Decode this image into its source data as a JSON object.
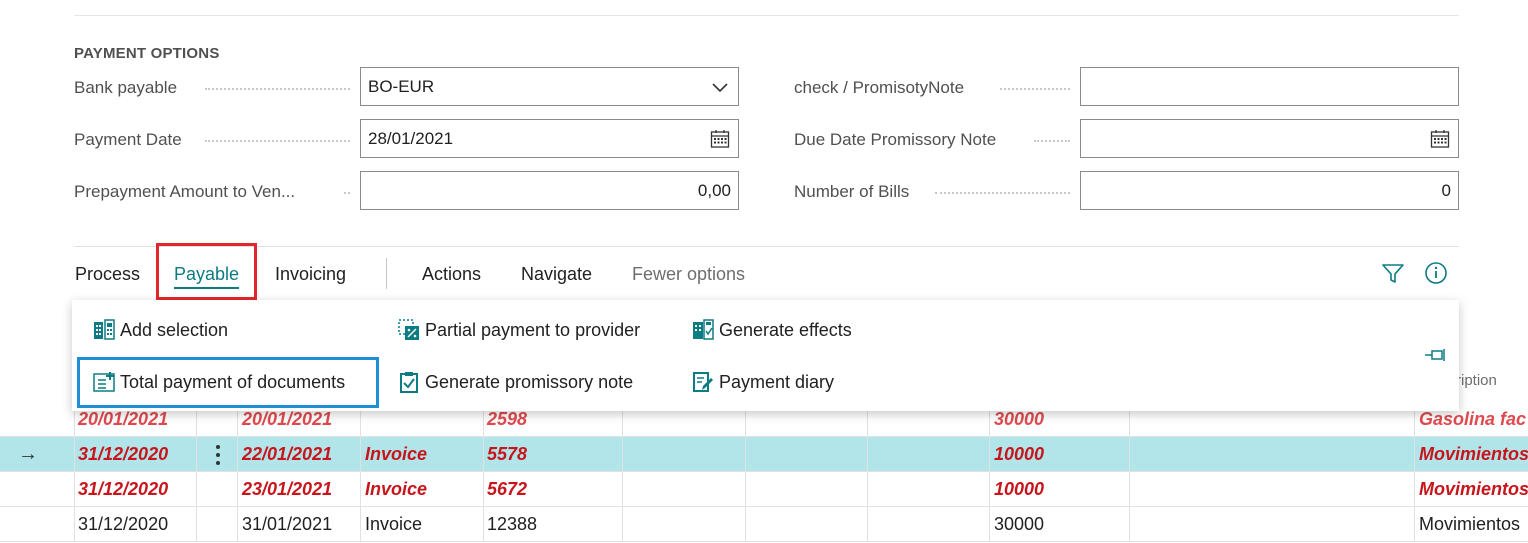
{
  "payment_options": {
    "title": "PAYMENT OPTIONS",
    "bank_payable": {
      "label": "Bank payable",
      "value": "BO-EUR"
    },
    "payment_date": {
      "label": "Payment Date",
      "value": "28/01/2021"
    },
    "prepayment_amount": {
      "label": "Prepayment Amount to Ven...",
      "value": "0,00"
    },
    "check_promissory": {
      "label": "check / PromisotyNote",
      "value": ""
    },
    "due_date_promissory": {
      "label": "Due Date Promissory Note",
      "value": ""
    },
    "number_of_bills": {
      "label": "Number of Bills",
      "value": "0"
    }
  },
  "tabs": [
    {
      "label": "Process"
    },
    {
      "label": "Payable"
    },
    {
      "label": "Invoicing"
    },
    {
      "label": "Actions"
    },
    {
      "label": "Navigate"
    },
    {
      "label": "Fewer options"
    }
  ],
  "payable_actions": [
    {
      "label": "Add selection",
      "icon": "add-selection-icon"
    },
    {
      "label": "Total payment of documents",
      "icon": "total-payment-icon"
    },
    {
      "label": "Partial payment to provider",
      "icon": "partial-payment-icon"
    },
    {
      "label": "Generate promissory note",
      "icon": "clipboard-check-icon"
    },
    {
      "label": "Generate effects",
      "icon": "generate-effects-icon"
    },
    {
      "label": "Payment diary",
      "icon": "payment-diary-icon"
    }
  ],
  "grid": {
    "header_peek": "ription",
    "rows": [
      {
        "posting_date": "20/01/2021",
        "due_date": "20/01/2021",
        "doc_type": "",
        "doc_no": "2598",
        "vendor": "30000",
        "description": "Gasolina fac",
        "style": "bold-partial"
      },
      {
        "posting_date": "31/12/2020",
        "due_date": "22/01/2021",
        "doc_type": "Invoice",
        "doc_no": "5578",
        "vendor": "10000",
        "description": "Movimientos",
        "style": "bold-selected",
        "marker": "→"
      },
      {
        "posting_date": "31/12/2020",
        "due_date": "23/01/2021",
        "doc_type": "Invoice",
        "doc_no": "5672",
        "vendor": "10000",
        "description": "Movimientos",
        "style": "bold"
      },
      {
        "posting_date": "31/12/2020",
        "due_date": "31/01/2021",
        "doc_type": "Invoice",
        "doc_no": "12388",
        "vendor": "30000",
        "description": "Movimientos",
        "style": "normal"
      }
    ]
  },
  "colors": {
    "accent": "#0b7c83",
    "overdue_red": "#c8151c",
    "selected_row": "#b2e5e9",
    "highlight_red": "#e3262e",
    "highlight_blue": "#1e8fd6"
  }
}
